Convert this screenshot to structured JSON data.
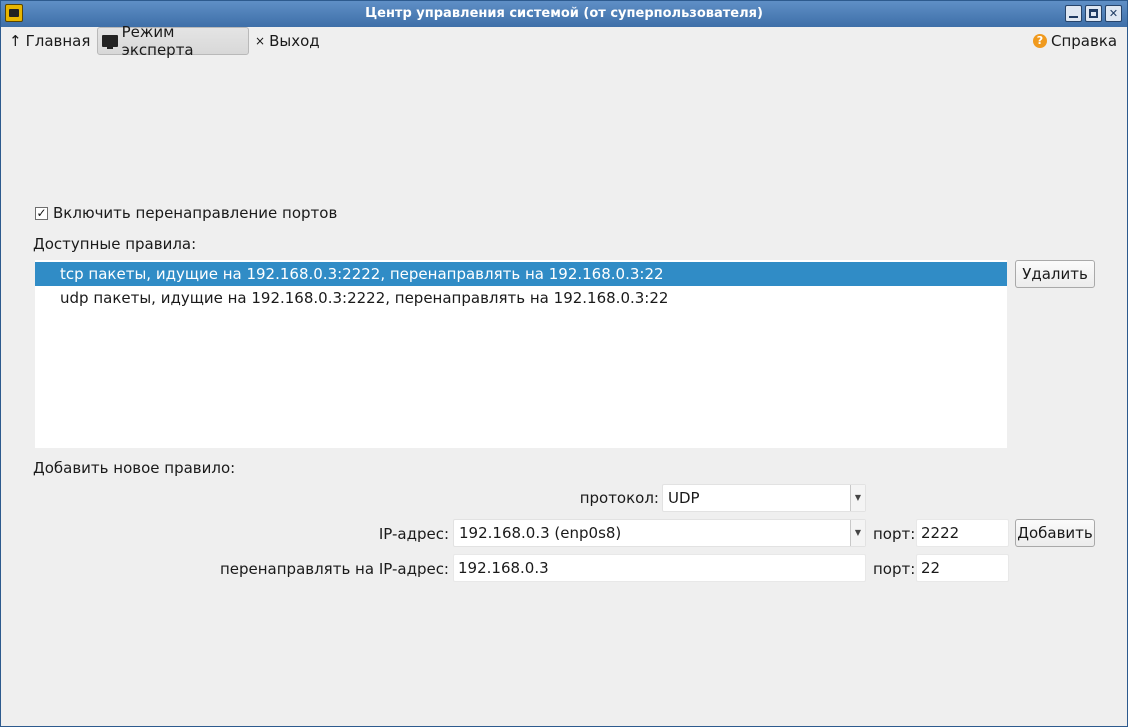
{
  "window": {
    "title": "Центр управления системой (от суперпользователя)"
  },
  "toolbar": {
    "home_glyph": "↑",
    "home_label": "Главная",
    "expert_label": "Режим эксперта",
    "exit_glyph": "×",
    "exit_label": "Выход",
    "help_glyph": "?",
    "help_label": "Справка"
  },
  "port_forwarding": {
    "enable_checkbox_label": "Включить перенаправление портов",
    "enable_checked": true,
    "check_glyph": "✓",
    "available_rules_label": "Доступные правила:",
    "rules": [
      {
        "text": "tcp пакеты, идущие на 192.168.0.3:2222, перенаправлять на 192.168.0.3:22",
        "selected": true
      },
      {
        "text": "udp пакеты, идущие на 192.168.0.3:2222, перенаправлять на 192.168.0.3:22",
        "selected": false
      }
    ],
    "delete_button": "Удалить",
    "add_rule_label": "Добавить новое правило:",
    "protocol_label": "протокол:",
    "protocol_value": "UDP",
    "ip_label": "IP-адрес:",
    "ip_value": "192.168.0.3 (enp0s8)",
    "port_label": "порт:",
    "port_value": "2222",
    "add_button": "Добавить",
    "redirect_ip_label": "перенаправлять на IP-адрес:",
    "redirect_ip_value": "192.168.0.3",
    "redirect_port_label": "порт:",
    "redirect_port_value": "22",
    "dropdown_glyph": "▼"
  },
  "colors": {
    "selection": "#308cc6",
    "titlebar": "#3e6fa8",
    "background": "#efefef"
  }
}
